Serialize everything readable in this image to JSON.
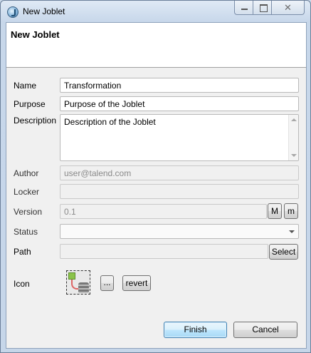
{
  "window": {
    "title": "New Joblet",
    "close_glyph": "✕"
  },
  "header": {
    "title": "New Joblet"
  },
  "form": {
    "name": {
      "label": "Name",
      "value": "Transformation"
    },
    "purpose": {
      "label": "Purpose",
      "value": "Purpose of the Joblet"
    },
    "description": {
      "label": "Description",
      "value": "Description of the Joblet"
    },
    "author": {
      "label": "Author",
      "value": "user@talend.com"
    },
    "locker": {
      "label": "Locker",
      "value": ""
    },
    "version": {
      "label": "Version",
      "value": "0.1",
      "major_label": "M",
      "minor_label": "m"
    },
    "status": {
      "label": "Status",
      "value": ""
    },
    "path": {
      "label": "Path",
      "value": "",
      "select_label": "Select"
    },
    "icon": {
      "label": "Icon",
      "browse_label": "...",
      "revert_label": "revert"
    }
  },
  "footer": {
    "finish_label": "Finish",
    "cancel_label": "Cancel"
  }
}
